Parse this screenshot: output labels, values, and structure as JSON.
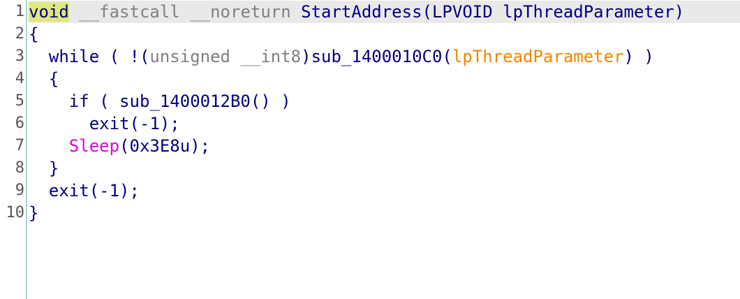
{
  "editor": {
    "lines": [
      {
        "num": "1",
        "tokens": [
          {
            "text": "void",
            "color": "#000080",
            "highlight": "#dfe87a"
          },
          {
            "text": " ",
            "color": "#000080"
          },
          {
            "text": "__fastcall __noreturn",
            "color": "#808080"
          },
          {
            "text": " StartAddress(LPVOID lpThreadParameter)",
            "color": "#000080"
          }
        ]
      },
      {
        "num": "2",
        "tokens": [
          {
            "text": "{",
            "color": "#000080"
          }
        ]
      },
      {
        "num": "3",
        "tokens": [
          {
            "text": "  while ( !(",
            "color": "#000080"
          },
          {
            "text": "unsigned __int8",
            "color": "#808080"
          },
          {
            "text": ")sub_1400010C0(",
            "color": "#000080"
          },
          {
            "text": "lpThreadParameter",
            "color": "#f28500"
          },
          {
            "text": ") )",
            "color": "#000080"
          }
        ]
      },
      {
        "num": "4",
        "tokens": [
          {
            "text": "  {",
            "color": "#000080"
          }
        ]
      },
      {
        "num": "5",
        "tokens": [
          {
            "text": "    if ( sub_1400012B0() )",
            "color": "#000080"
          }
        ]
      },
      {
        "num": "6",
        "tokens": [
          {
            "text": "      exit(-1);",
            "color": "#000080"
          }
        ]
      },
      {
        "num": "7",
        "tokens": [
          {
            "text": "    ",
            "color": "#000080"
          },
          {
            "text": "Sleep",
            "color": "#e000e0"
          },
          {
            "text": "(0x3E8u);",
            "color": "#000080"
          }
        ]
      },
      {
        "num": "8",
        "tokens": [
          {
            "text": "  }",
            "color": "#000080"
          }
        ]
      },
      {
        "num": "9",
        "tokens": [
          {
            "text": "  exit(-1);",
            "color": "#000080"
          }
        ]
      },
      {
        "num": "10",
        "tokens": [
          {
            "text": "}",
            "color": "#000080"
          }
        ]
      }
    ]
  }
}
